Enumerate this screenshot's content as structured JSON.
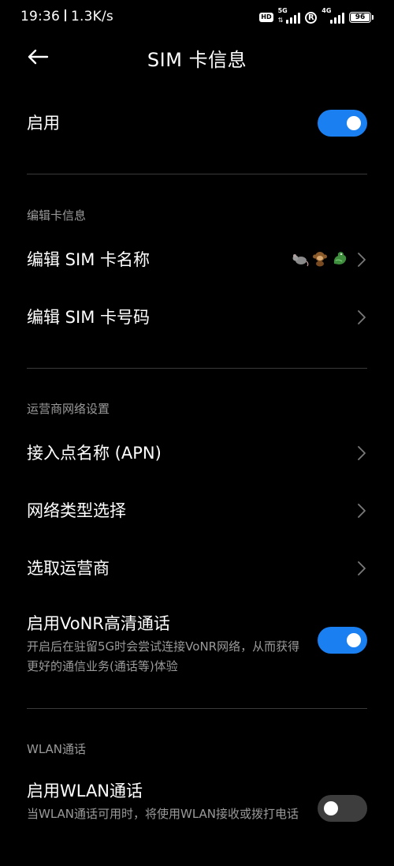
{
  "status_bar": {
    "time": "19:36",
    "speed": "1.3K/s",
    "hd": "HD",
    "sim1_network": "5G",
    "sim2_network": "4G",
    "r_label": "R",
    "battery": "96"
  },
  "header": {
    "title": "SIM 卡信息"
  },
  "enable": {
    "label": "启用",
    "state": true
  },
  "edit_section": {
    "label": "编辑卡信息",
    "edit_name": "编辑 SIM 卡名称",
    "edit_name_icons": [
      "rat-icon",
      "monkey-icon",
      "dragon-icon"
    ],
    "edit_number": "编辑 SIM 卡号码"
  },
  "carrier_section": {
    "label": "运营商网络设置",
    "apn": "接入点名称 (APN)",
    "network_type": "网络类型选择",
    "choose_carrier": "选取运营商",
    "vonr_title": "启用VoNR高清通话",
    "vonr_desc": "开启后在驻留5G时会尝试连接VoNR网络，从而获得更好的通信业务(通话等)体验",
    "vonr_state": true
  },
  "wlan_section": {
    "label": "WLAN通话",
    "wlan_title": "启用WLAN通话",
    "wlan_desc": "当WLAN通话可用时，将使用WLAN接收或拨打电话",
    "wlan_state": false
  },
  "colors": {
    "accent": "#1a7ff0",
    "background": "#000000",
    "secondary_text": "#9a9a9a",
    "divider": "#3a3a3a"
  }
}
